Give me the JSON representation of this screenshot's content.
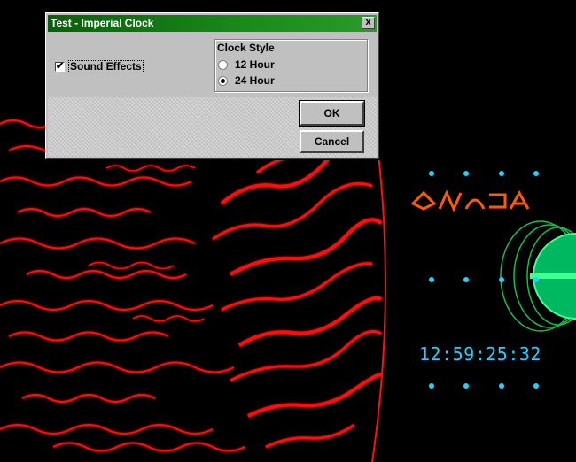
{
  "dialog": {
    "title": "Test - Imperial Clock",
    "close_glyph": "x",
    "sound_effects_label": "Sound Effects",
    "sound_effects_checked": true,
    "clock_style": {
      "title": "Clock Style",
      "options": [
        "12 Hour",
        "24 Hour"
      ],
      "selected": "24 Hour"
    },
    "ok_label": "OK",
    "cancel_label": "Cancel"
  },
  "clock": {
    "time": "12:59:25:32"
  },
  "colors": {
    "title_bar": "#0a5f0a",
    "dialog_face": "#c0c0c0",
    "time_text": "#22d0ff",
    "glyph_orange": "#ff5a00",
    "ring_green": "#10c050",
    "plasma_red": "#ff1010"
  }
}
